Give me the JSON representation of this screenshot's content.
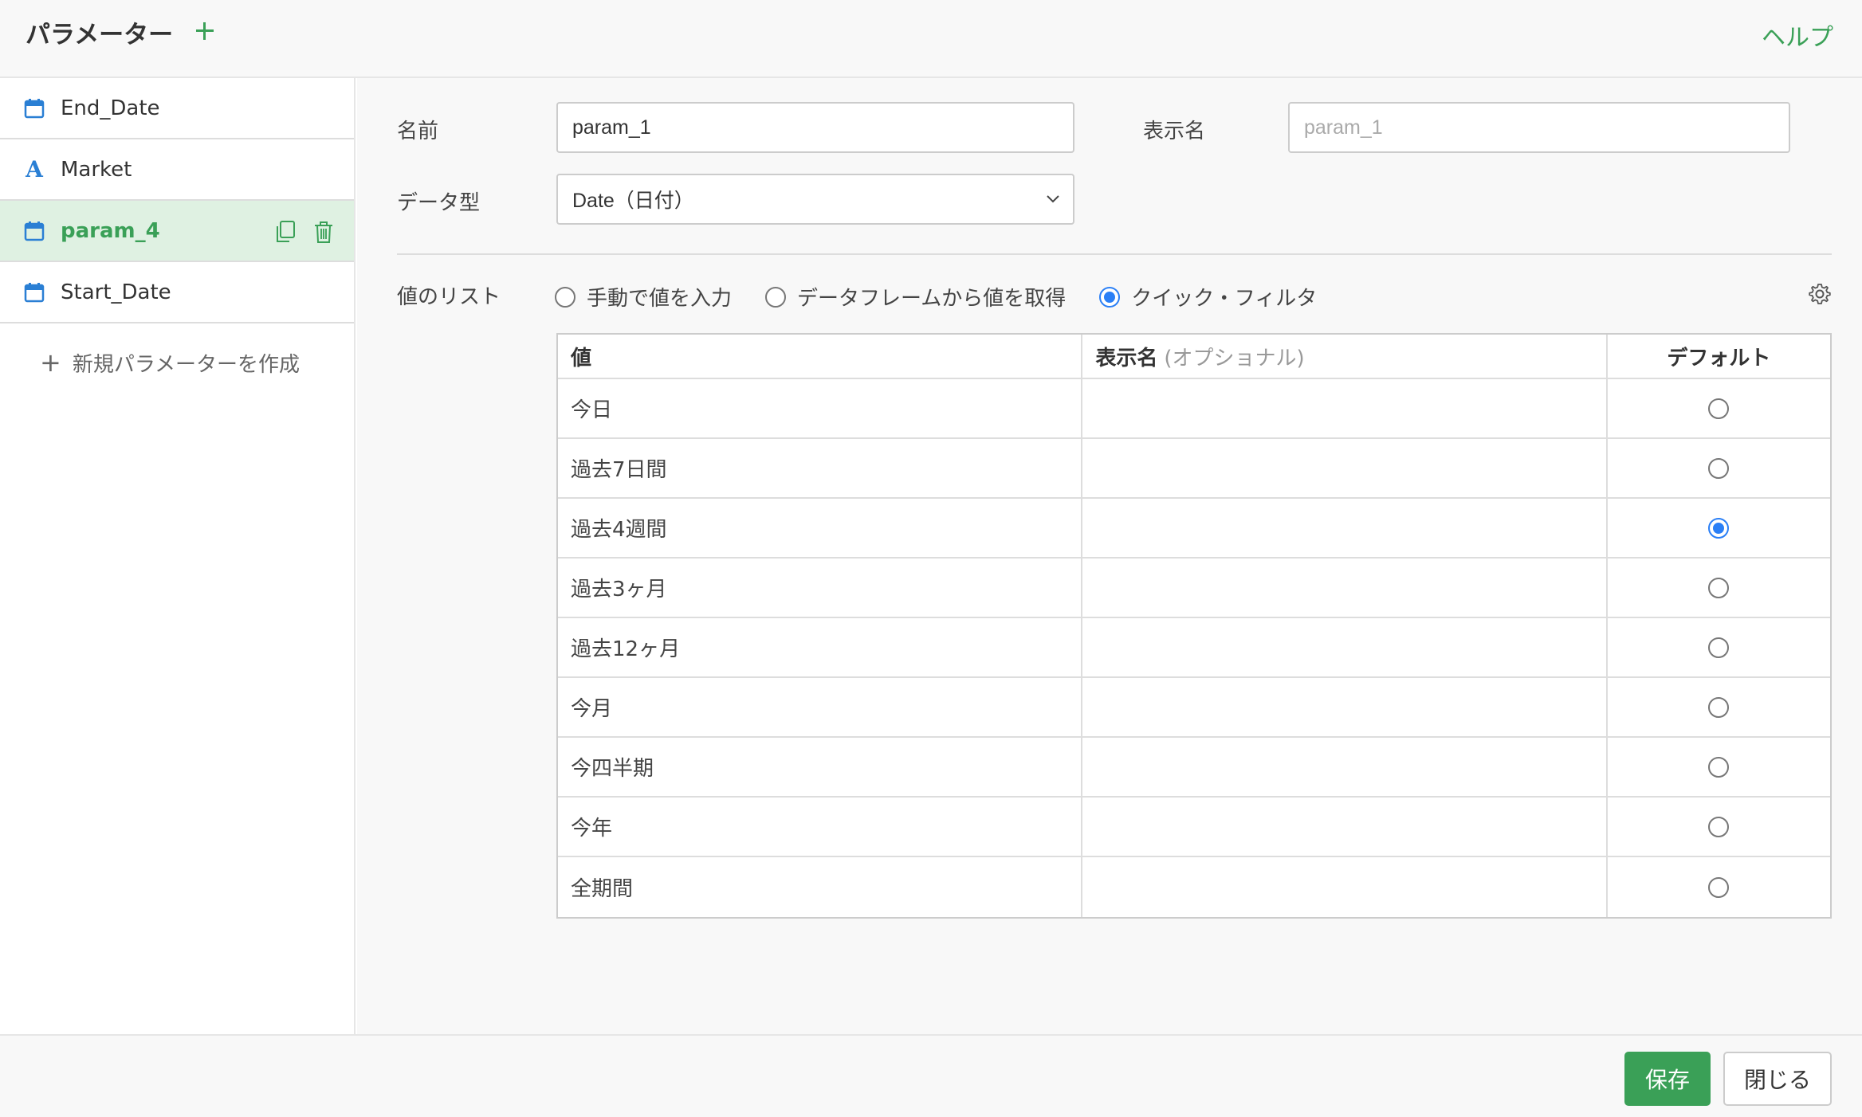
{
  "header": {
    "title": "パラメーター",
    "help_label": "ヘルプ"
  },
  "sidebar": {
    "items": [
      {
        "label": "End_Date",
        "icon": "calendar-icon"
      },
      {
        "label": "Market",
        "icon": "text-type-icon"
      },
      {
        "label": "param_4",
        "icon": "calendar-icon",
        "active": true
      },
      {
        "label": "Start_Date",
        "icon": "calendar-icon"
      }
    ],
    "new_param_label": "新規パラメーターを作成"
  },
  "form": {
    "name_label": "名前",
    "name_value": "param_1",
    "display_name_label": "表示名",
    "display_name_placeholder": "param_1",
    "data_type_label": "データ型",
    "data_type_value": "Date（日付）",
    "value_list_label": "値のリスト",
    "value_list_options": [
      {
        "label": "手動で値を入力",
        "checked": false
      },
      {
        "label": "データフレームから値を取得",
        "checked": false
      },
      {
        "label": "クイック・フィルタ",
        "checked": true
      }
    ]
  },
  "table": {
    "headers": {
      "value": "値",
      "display_name": "表示名",
      "display_name_optional": "(オプショナル)",
      "default": "デフォルト"
    },
    "rows": [
      {
        "value": "今日",
        "display_name": "",
        "default": false
      },
      {
        "value": "過去7日間",
        "display_name": "",
        "default": false
      },
      {
        "value": "過去4週間",
        "display_name": "",
        "default": true
      },
      {
        "value": "過去3ヶ月",
        "display_name": "",
        "default": false
      },
      {
        "value": "過去12ヶ月",
        "display_name": "",
        "default": false
      },
      {
        "value": "今月",
        "display_name": "",
        "default": false
      },
      {
        "value": "今四半期",
        "display_name": "",
        "default": false
      },
      {
        "value": "今年",
        "display_name": "",
        "default": false
      },
      {
        "value": "全期間",
        "display_name": "",
        "default": false
      }
    ]
  },
  "footer": {
    "save_label": "保存",
    "close_label": "閉じる"
  },
  "colors": {
    "accent": "#3aa057",
    "active_bg": "#dff1e2",
    "radio_checked": "#2a7ff6",
    "icon_blue": "#2a7fd4"
  }
}
